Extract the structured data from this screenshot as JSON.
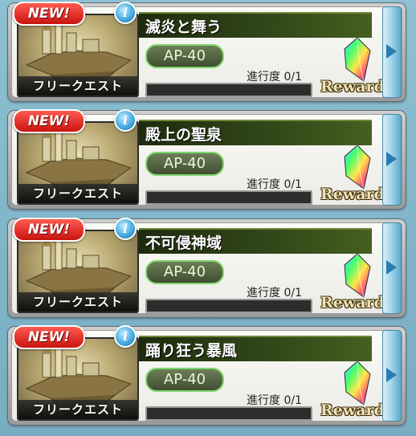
{
  "quests": [
    {
      "badge": "NEW!",
      "info_symbol": "i",
      "thumb_label": "フリークエスト",
      "title": "滅炎と舞う",
      "ap": "AP-40",
      "progress_label": "進行度 0/1",
      "progress_fraction": 0,
      "reward_label": "Reward",
      "arrow_icon": "chevron-right-icon"
    },
    {
      "badge": "NEW!",
      "info_symbol": "i",
      "thumb_label": "フリークエスト",
      "title": "殿上の聖泉",
      "ap": "AP-40",
      "progress_label": "進行度 0/1",
      "progress_fraction": 0,
      "reward_label": "Reward",
      "arrow_icon": "chevron-right-icon"
    },
    {
      "badge": "NEW!",
      "info_symbol": "i",
      "thumb_label": "フリークエスト",
      "title": "不可侵神域",
      "ap": "AP-40",
      "progress_label": "進行度 0/1",
      "progress_fraction": 0,
      "reward_label": "Reward",
      "arrow_icon": "chevron-right-icon"
    },
    {
      "badge": "NEW!",
      "info_symbol": "i",
      "thumb_label": "フリークエスト",
      "title": "踊り狂う暴風",
      "ap": "AP-40",
      "progress_label": "進行度 0/1",
      "progress_fraction": 0,
      "reward_label": "Reward",
      "arrow_icon": "chevron-right-icon"
    }
  ],
  "colors": {
    "title_bar": "#33491a",
    "ap_border": "#7fd46b",
    "badge_red": "#d81e16",
    "info_blue": "#3ea6dd",
    "arrow_blue": "#2a7cb0"
  }
}
